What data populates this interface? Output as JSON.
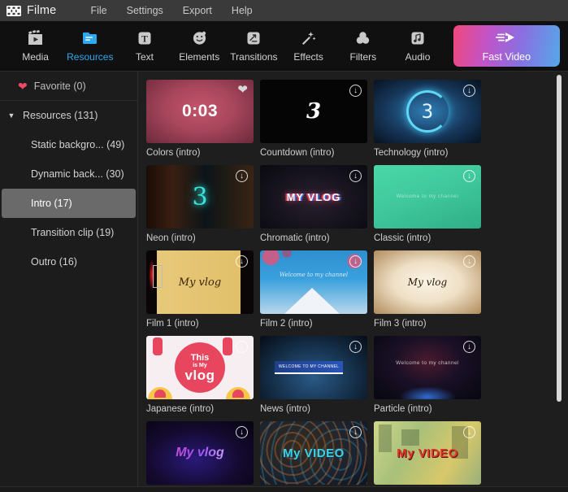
{
  "app": {
    "name": "Filme",
    "logo_icon": "film-strip-icon"
  },
  "menu": {
    "items": [
      {
        "label": "File"
      },
      {
        "label": "Settings"
      },
      {
        "label": "Export"
      },
      {
        "label": "Help"
      }
    ]
  },
  "toolbar": {
    "items": [
      {
        "label": "Media",
        "icon": "clapperboard-icon",
        "active": false
      },
      {
        "label": "Resources",
        "icon": "document-icon",
        "active": true
      },
      {
        "label": "Text",
        "icon": "text-t-icon",
        "active": false
      },
      {
        "label": "Elements",
        "icon": "smiley-face-icon",
        "active": false
      },
      {
        "label": "Transitions",
        "icon": "transition-icon",
        "active": false
      },
      {
        "label": "Effects",
        "icon": "magic-wand-icon",
        "active": false
      },
      {
        "label": "Filters",
        "icon": "color-circles-icon",
        "active": false
      },
      {
        "label": "Audio",
        "icon": "music-note-icon",
        "active": false
      }
    ],
    "fast_video": {
      "label": "Fast Video",
      "icon": "fast-forward-arrow-icon"
    }
  },
  "sidebar": {
    "favorite": {
      "label": "Favorite (0)",
      "icon": "heart-icon",
      "icon_color": "#ef4a63"
    },
    "group": {
      "label": "Resources (131)",
      "caret": "▼",
      "expanded": true
    },
    "categories": [
      {
        "label": "Static backgro... (49)",
        "selected": false
      },
      {
        "label": "Dynamic back... (30)",
        "selected": false
      },
      {
        "label": "Intro (17)",
        "selected": true
      },
      {
        "label": "Transition clip (19)",
        "selected": false
      },
      {
        "label": "Outro (16)",
        "selected": false
      }
    ]
  },
  "content": {
    "items": [
      {
        "name": "Colors (intro)",
        "art": "t-colors",
        "badge": "favorite",
        "duration": "0:03",
        "art_text": ""
      },
      {
        "name": "Countdown (intro)",
        "art": "t-countdown",
        "badge": "download",
        "duration": "",
        "art_text": "3"
      },
      {
        "name": "Technology (intro)",
        "art": "t-technology",
        "badge": "download",
        "duration": "",
        "art_text": "3"
      },
      {
        "name": "Neon (intro)",
        "art": "t-neon",
        "badge": "download",
        "duration": "",
        "art_text": "3"
      },
      {
        "name": "Chromatic (intro)",
        "art": "t-chromatic",
        "badge": "download",
        "duration": "",
        "art_text": "MY VLOG"
      },
      {
        "name": "Classic (intro)",
        "art": "t-classic",
        "badge": "download",
        "duration": "",
        "art_text": "Welcome to my channel"
      },
      {
        "name": "Film 1 (intro)",
        "art": "t-film1",
        "badge": "download",
        "duration": "",
        "art_text": "My vlog"
      },
      {
        "name": "Film 2 (intro)",
        "art": "t-film2",
        "badge": "download",
        "duration": "",
        "art_text": "Welcome to my channel"
      },
      {
        "name": "Film 3 (intro)",
        "art": "t-film3",
        "badge": "download",
        "duration": "",
        "art_text": "My vlog"
      },
      {
        "name": "Japanese (intro)",
        "art": "t-japanese",
        "badge": "download",
        "duration": "",
        "art_text": "This is My vlog"
      },
      {
        "name": "News (intro)",
        "art": "t-news",
        "badge": "download",
        "duration": "",
        "art_text": "WELCOME TO MY CHANNEL"
      },
      {
        "name": "Particle (intro)",
        "art": "t-particle",
        "badge": "download",
        "duration": "",
        "art_text": "Welcome to my channel"
      },
      {
        "name": "",
        "art": "t-myvlog",
        "badge": "download",
        "duration": "",
        "art_text": "My vlog"
      },
      {
        "name": "",
        "art": "t-myvideo1",
        "badge": "download",
        "duration": "",
        "art_text": "My VIDEO"
      },
      {
        "name": "",
        "art": "t-myvideo2",
        "badge": "download",
        "duration": "",
        "art_text": "My VIDEO"
      }
    ],
    "download_icon": "download-circle-icon",
    "favorite_icon": "heart-filled-icon"
  },
  "scrollbar": {
    "visible": true,
    "thumb_color": "#d8d8d8"
  },
  "colors": {
    "titlebar_bg": "#3a3a3a",
    "toolbar_bg": "#101010",
    "sidebar_bg": "#1c1c1c",
    "content_bg": "#1e1e1e",
    "accent": "#2fa8f0",
    "selected_row": "#6a6a6a"
  }
}
